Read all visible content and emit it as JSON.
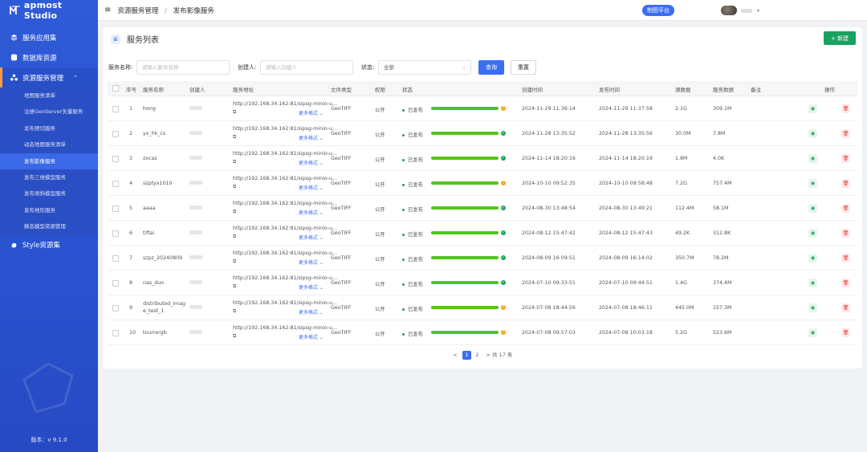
{
  "app": {
    "logo_text": "apmost Studio",
    "version": "版本：v 9.1.0"
  },
  "sidebar": {
    "items": [
      {
        "label": "服务应用集",
        "icon": "layers-icon"
      },
      {
        "label": "数据库资源",
        "icon": "database-icon"
      },
      {
        "label": "资源服务管理",
        "icon": "cluster-icon"
      },
      {
        "label": "Style资源集",
        "icon": "style-icon"
      }
    ],
    "subitems": [
      "地图服务清单",
      "注册GeoServer矢量服务",
      "发布预切服务",
      "动态地图服务清单",
      "发布影像服务",
      "发布三维模型服务",
      "发布倾斜模型服务",
      "发布地形服务",
      "静态模型资源管理"
    ],
    "active_sub_index": 4
  },
  "header": {
    "breadcrumb": [
      "资源服务管理",
      "发布影像服务"
    ],
    "map_platform": "制图平台"
  },
  "card": {
    "title": "服务列表",
    "new_button": "+ 新建"
  },
  "filters": {
    "name_label": "服务名称:",
    "name_placeholder": "请输入服务名称",
    "creator_label": "创建人:",
    "creator_placeholder": "请输入创建人",
    "status_label": "状态:",
    "status_value": "全部",
    "query_button": "查询",
    "reset_button": "重置"
  },
  "table": {
    "headers": [
      "序号",
      "服务名称",
      "创建人",
      "服务地址",
      "文件类型",
      "权限",
      "状态",
      "创建时间",
      "发布时间",
      "源数据",
      "服务数据",
      "备注",
      "操作"
    ],
    "url_text": "http://192.168.34.162:81/sipsg-minio-u...",
    "more_formats": "更多格式",
    "rows": [
      {
        "index": "1",
        "name": "hong",
        "name2": "",
        "type": "GeoTIFF",
        "perm": "公开",
        "status": "已发布",
        "warn": true,
        "created": "2024-11-29 11:36:14",
        "published": "2024-11-29 11:37:58",
        "source": "2.1G",
        "service": "309.1M"
      },
      {
        "index": "2",
        "name": "yx_hk_cs",
        "name2": "",
        "type": "GeoTIFF",
        "perm": "公开",
        "status": "已发布",
        "warn": false,
        "created": "2024-11-28 13:35:52",
        "published": "2024-11-28 13:35:56",
        "source": "30.0M",
        "service": "7.8M"
      },
      {
        "index": "3",
        "name": "zxcas",
        "name2": "",
        "type": "GeoTIFF",
        "perm": "公开",
        "status": "已发布",
        "warn": false,
        "created": "2024-11-14 18:20:16",
        "published": "2024-11-14 18:20:19",
        "source": "1.8M",
        "service": "4.0K"
      },
      {
        "index": "4",
        "name": "szptyx1010",
        "name2": "",
        "type": "GeoTIFF",
        "perm": "公开",
        "status": "已发布",
        "warn": true,
        "created": "2024-10-10 09:52:35",
        "published": "2024-10-10 09:58:48",
        "source": "7.2G",
        "service": "757.4M"
      },
      {
        "index": "5",
        "name": "aaaa",
        "name2": "",
        "type": "GeoTIFF",
        "perm": "公开",
        "status": "已发布",
        "warn": false,
        "created": "2024-08-30 13:48:54",
        "published": "2024-08-30 13:49:21",
        "source": "112.4M",
        "service": "58.1M"
      },
      {
        "index": "6",
        "name": "tiftai",
        "name2": "",
        "type": "GeoTIFF",
        "perm": "公开",
        "status": "已发布",
        "warn": false,
        "created": "2024-08-12 15:47:42",
        "published": "2024-08-12 15:47:43",
        "source": "49.2K",
        "service": "312.8K"
      },
      {
        "index": "7",
        "name": "szpz_20240809",
        "name2": "",
        "type": "GeoTIFF",
        "perm": "公开",
        "status": "已发布",
        "warn": false,
        "created": "2024-08-09 16:09:51",
        "published": "2024-08-09 16:14:02",
        "source": "350.7M",
        "service": "78.2M"
      },
      {
        "index": "8",
        "name": "nas_duo",
        "name2": "",
        "type": "GeoTIFF",
        "perm": "公开",
        "status": "已发布",
        "warn": false,
        "created": "2024-07-10 09:33:51",
        "published": "2024-07-10 09:44:51",
        "source": "1.4G",
        "service": "374.4M"
      },
      {
        "index": "9",
        "name": "distributed_imag",
        "name2": "e_test_1",
        "type": "GeoTIFF",
        "perm": "公开",
        "status": "已发布",
        "warn": true,
        "created": "2024-07-08 18:44:56",
        "published": "2024-07-08 18:46:11",
        "source": "445.0M",
        "service": "157.3M"
      },
      {
        "index": "10",
        "name": "tourrergb",
        "name2": "",
        "type": "GeoTIFF",
        "perm": "公开",
        "status": "已发布",
        "warn": true,
        "created": "2024-07-08 09:57:03",
        "published": "2024-07-08 10:03:18",
        "source": "5.2G",
        "service": "523.6M"
      }
    ]
  },
  "pagination": {
    "prev": "<",
    "pages": [
      "1",
      "2"
    ],
    "next": ">",
    "total": "共 17 条"
  },
  "colors": {
    "sidebar": "#2f5bd8",
    "primary": "#3b6ef5",
    "success": "#19a15f",
    "warning": "#f5a623",
    "danger": "#e54545"
  }
}
